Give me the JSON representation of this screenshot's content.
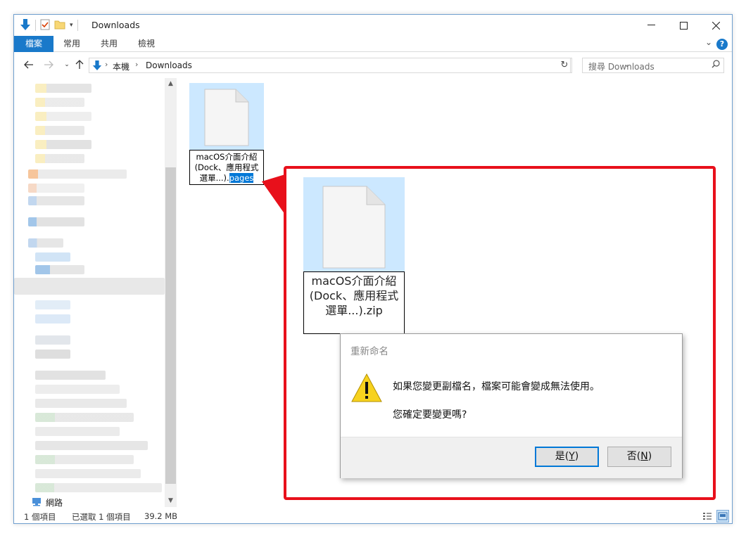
{
  "window": {
    "title": "Downloads"
  },
  "ribbon": {
    "tabs": [
      "檔案",
      "常用",
      "共用",
      "檢視"
    ]
  },
  "address": {
    "crumbs": [
      "本機",
      "Downloads"
    ]
  },
  "search": {
    "placeholder": "搜尋 Downloads"
  },
  "navpane": {
    "network_label": "網路"
  },
  "file": {
    "name_line1": "macOS介面介紹",
    "name_line2": "(Dock、應用程式",
    "name_line3_prefix": "選單...).",
    "name_ext_selected": "pages"
  },
  "zoom": {
    "name_line1": "macOS介面介紹",
    "name_line2": "(Dock、應用程式",
    "name_line3": "選單...).zip"
  },
  "dialog": {
    "title": "重新命名",
    "message_1": "如果您變更副檔名，檔案可能會變成無法使用。",
    "message_2": "您確定要變更嗎?",
    "yes_text": "是",
    "yes_key": "Y",
    "no_text": "否",
    "no_key": "N"
  },
  "status": {
    "item_count": "1 個項目",
    "selected": "已選取 1 個項目",
    "size": "39.2 MB"
  },
  "colors": {
    "accent": "#1979ca",
    "selection": "#cce8ff",
    "callout_border": "#e8101b",
    "warning": "#f7d21e"
  }
}
